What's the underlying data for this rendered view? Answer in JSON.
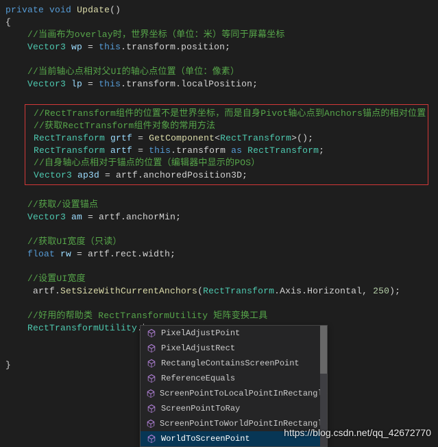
{
  "code": {
    "l1_private": "private",
    "l1_void": "void",
    "l1_method": "Update",
    "l1_paren": "()",
    "brace_open": "{",
    "brace_close": "}",
    "c1": "//当画布为overlay时，世界坐标（单位：米）等同于屏幕坐标",
    "l2_type": "Vector3",
    "l2_ident": "wp",
    "eq": " = ",
    "l2_this": "this",
    "l2_rest": ".transform.position;",
    "c2": "//当前轴心点相对父UI的轴心点位置（单位：像素）",
    "l3_type": "Vector3",
    "l3_ident": "lp",
    "l3_this": "this",
    "l3_rest": ".transform.localPosition;",
    "c3a": "//RectTransform组件的位置不是世界坐标，而是自身Pivot轴心点到Anchors锚点的相对位置",
    "c3b": "//获取RectTransform组件对象的常用方法",
    "l4_type": "RectTransform",
    "l4_ident": "grtf",
    "l4_method": "GetComponent",
    "l4_lt": "<",
    "l4_gen": "RectTransform",
    "l4_gt": ">();",
    "l5_type": "RectTransform",
    "l5_ident": "artf",
    "l5_this": "this",
    "l5_dot": ".transform ",
    "l5_as": "as",
    "l5_cast": " RectTransform",
    "semi": ";",
    "c4": "//自身轴心点相对于锚点的位置（编辑器中显示的POS）",
    "l6_type": "Vector3",
    "l6_ident": "ap3d",
    "l6_rest": " = artf.anchoredPosition3D;",
    "c5": "//获取/设置锚点",
    "l7_type": "Vector3",
    "l7_ident": "am",
    "l7_rest": " = artf.anchorMin;",
    "c6": "//获取UI宽度（只读）",
    "l8_type": "float",
    "l8_ident": "rw",
    "l8_rest": " = artf.rect.width;",
    "c7": "//设置UI宽度",
    "l9_pre": " artf.",
    "l9_method": "SetSizeWithCurrentAnchors",
    "l9_lp": "(",
    "l9_enum": "RectTransform",
    "l9_mid": ".Axis.Horizontal, ",
    "l9_num": "250",
    "l9_rp": ");",
    "c8": "//好用的帮助类 RectTransformUtility 矩阵变换工具",
    "l10_type": "RectTransformUtility",
    "l10_dot": "."
  },
  "intellisense": {
    "items": [
      "PixelAdjustPoint",
      "PixelAdjustRect",
      "RectangleContainsScreenPoint",
      "ReferenceEquals",
      "ScreenPointToLocalPointInRectangle",
      "ScreenPointToRay",
      "ScreenPointToWorldPointInRectangle",
      "WorldToScreenPoint"
    ],
    "selected_index": 7
  },
  "watermark": "https://blog.csdn.net/qq_42672770"
}
